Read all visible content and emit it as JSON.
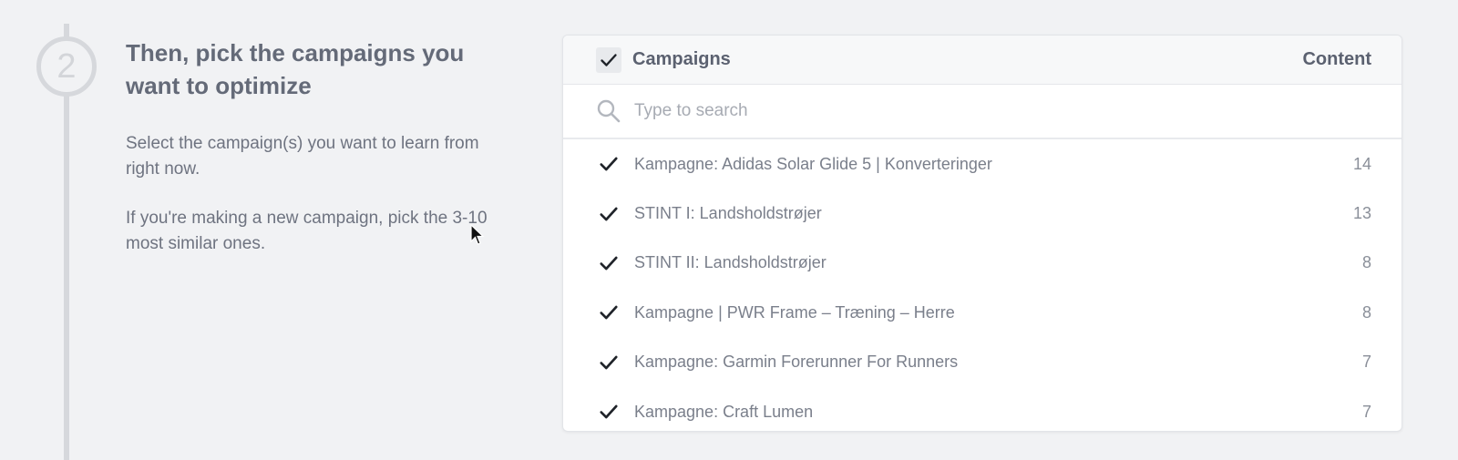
{
  "step": {
    "number": "2",
    "title": "Then, pick the campaigns you want to optimize",
    "paragraphs": [
      "Select the campaign(s) you want to learn from right now.",
      "If you're making a new campaign, pick the 3-10 most similar ones."
    ]
  },
  "panel": {
    "header": {
      "title": "Campaigns",
      "content_label": "Content",
      "select_all_checked": true
    },
    "search": {
      "placeholder": "Type to search",
      "value": ""
    },
    "rows": [
      {
        "name": "Kampagne: Adidas Solar Glide 5 | Konverteringer",
        "count": "14",
        "checked": true
      },
      {
        "name": "STINT I: Landsholdstrøjer",
        "count": "13",
        "checked": true
      },
      {
        "name": "STINT II: Landsholdstrøjer",
        "count": "8",
        "checked": true
      },
      {
        "name": "Kampagne | PWR Frame – Træning – Herre",
        "count": "8",
        "checked": true
      },
      {
        "name": "Kampagne: Garmin Forerunner For Runners",
        "count": "7",
        "checked": true
      },
      {
        "name": "Kampagne: Craft Lumen",
        "count": "7",
        "checked": true
      }
    ]
  },
  "colors": {
    "background": "#f1f2f4",
    "rail": "#d6d8dc",
    "checkmark": "#1f2329",
    "text": "#5f6573"
  },
  "icons": {
    "checkbox": "check-icon",
    "search": "search-icon",
    "cursor": "mouse-pointer-icon"
  }
}
